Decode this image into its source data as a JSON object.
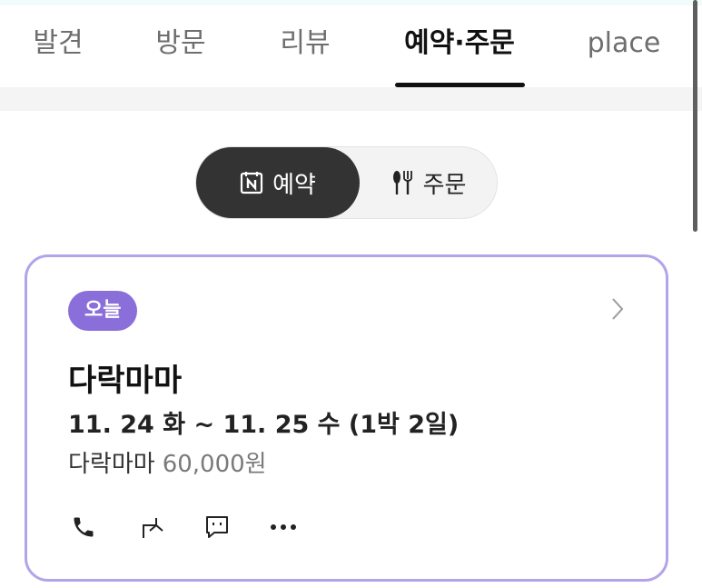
{
  "tabs": [
    {
      "label": "발견",
      "active": false
    },
    {
      "label": "방문",
      "active": false
    },
    {
      "label": "리뷰",
      "active": false
    },
    {
      "label": "예약·주문",
      "active": true
    },
    {
      "label": "place",
      "active": false
    }
  ],
  "toggle": {
    "reserve_label": "예약",
    "order_label": "주문",
    "selected": "예약"
  },
  "booking": {
    "badge": "오늘",
    "place_name": "다락마마",
    "dates": "11. 24 화 ~ 11. 25 수 (1박 2일)",
    "item_name": "다락마마",
    "price": "60,000원",
    "actions": [
      "phone-icon",
      "share-icon",
      "message-icon",
      "more-icon"
    ]
  },
  "colors": {
    "accent": "#8a6ed9",
    "card_border": "#b3a3ea",
    "toggle_active": "#333333"
  }
}
